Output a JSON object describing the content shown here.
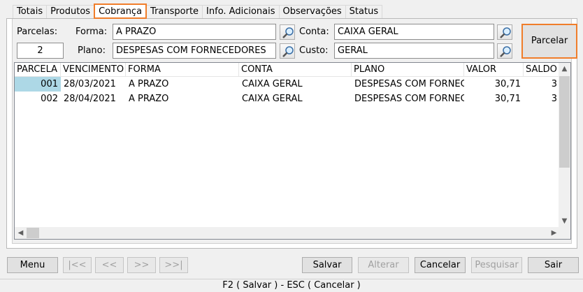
{
  "tabs": [
    "Totais",
    "Produtos",
    "Cobrança",
    "Transporte",
    "Info. Adicionais",
    "Observações",
    "Status"
  ],
  "form": {
    "parcelas_label": "Parcelas:",
    "parcelas_value": "2",
    "forma_label": "Forma:",
    "forma_value": "A PRAZO",
    "plano_label": "Plano:",
    "plano_value": "DESPESAS COM FORNECEDORES",
    "conta_label": "Conta:",
    "conta_value": "CAIXA GERAL",
    "custo_label": "Custo:",
    "custo_value": "GERAL",
    "parcelar_label": "Parcelar"
  },
  "grid": {
    "columns": [
      "PARCELA",
      "VENCIMENTO",
      "FORMA",
      "CONTA",
      "PLANO",
      "VALOR",
      "SALDO"
    ],
    "rows": [
      {
        "parcela": "001",
        "vencimento": "28/03/2021",
        "forma": "A PRAZO",
        "conta": "CAIXA GERAL",
        "plano": "DESPESAS COM FORNEC",
        "valor": "30,71",
        "saldo": "3"
      },
      {
        "parcela": "002",
        "vencimento": "28/04/2021",
        "forma": "A PRAZO",
        "conta": "CAIXA GERAL",
        "plano": "DESPESAS COM FORNEC",
        "valor": "30,71",
        "saldo": "3"
      }
    ]
  },
  "buttons": {
    "menu": "Menu",
    "first": "|<<",
    "prev": "<<",
    "next": ">>",
    "last": ">>|",
    "salvar": "Salvar",
    "alterar": "Alterar",
    "cancelar": "Cancelar",
    "pesquisar": "Pesquisar",
    "sair": "Sair"
  },
  "statusbar": "F2 ( Salvar )  -  ESC ( Cancelar )",
  "colors": {
    "accent": "#f07d2a",
    "selected_cell": "#add8e6"
  }
}
